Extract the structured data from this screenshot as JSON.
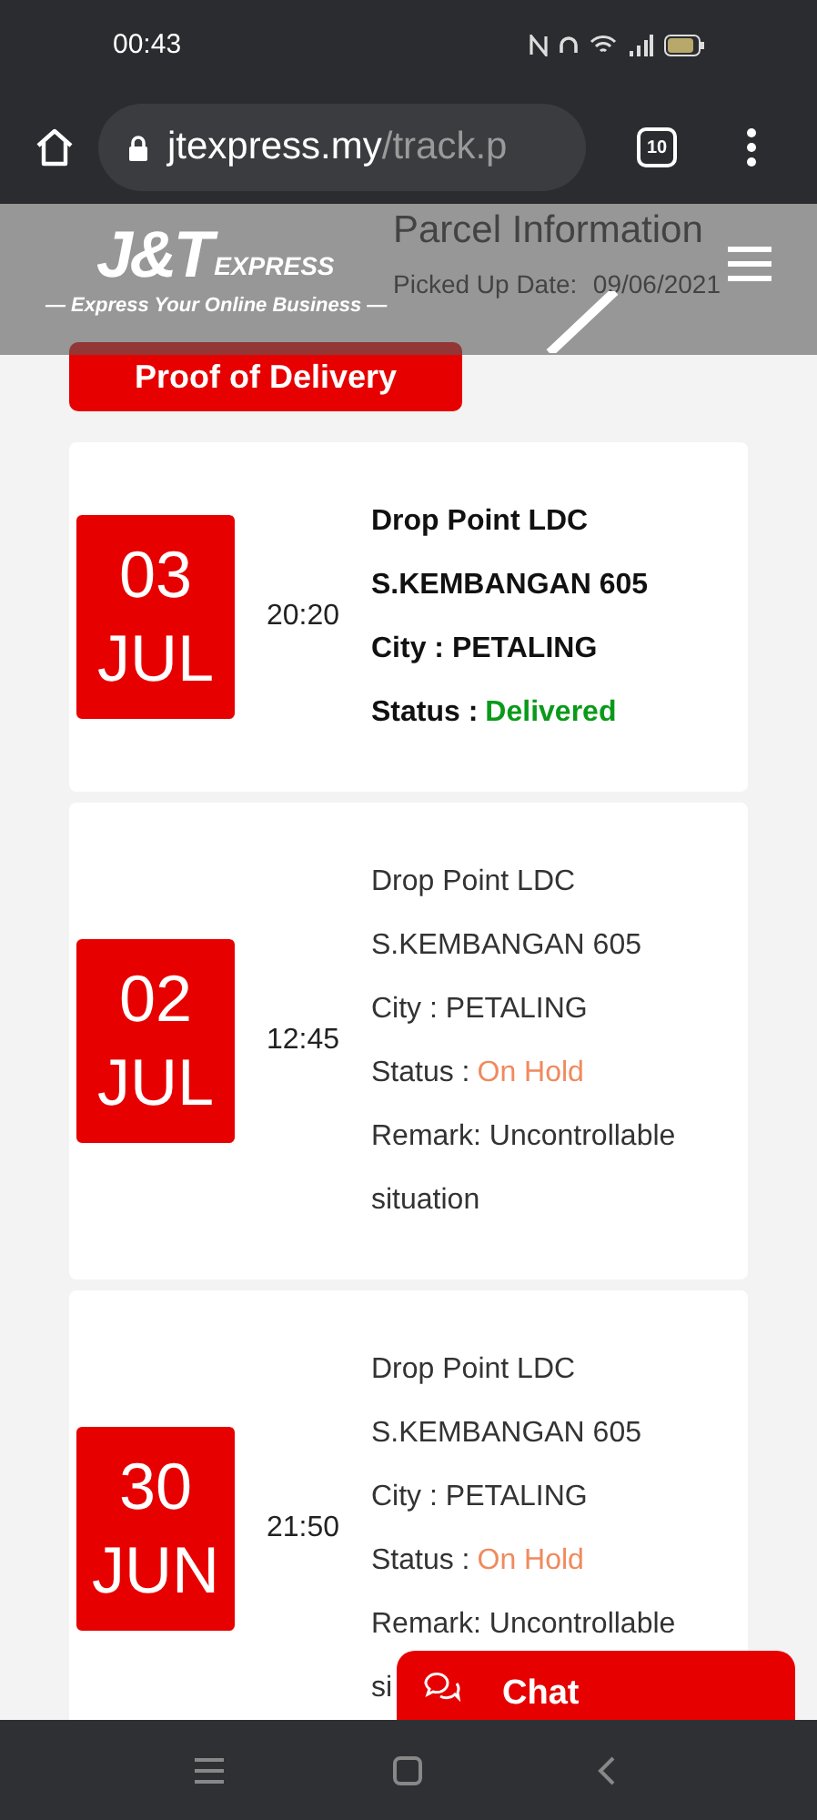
{
  "status_bar": {
    "time": "00:43"
  },
  "browser": {
    "url_host": "jtexpress.my",
    "url_path": "/track.p",
    "tab_count": "10"
  },
  "header": {
    "logo_mark": "J&T",
    "logo_word": "EXPRESS",
    "tagline": "— Express Your Online Business —"
  },
  "parcel_info": {
    "title": "Parcel Information",
    "picked_up_label": "Picked Up Date:",
    "picked_up_date": "09/06/2021"
  },
  "proof_button": "Proof of Delivery",
  "events": [
    {
      "day": "03",
      "month": "JUL",
      "time": "20:20",
      "highlighted": true,
      "location_lines": [
        "Drop Point LDC",
        "S.KEMBANGAN 605"
      ],
      "city": "City : PETALING",
      "status_label": "Status :",
      "status": "Delivered",
      "color": "#0a9a1a"
    },
    {
      "day": "02",
      "month": "JUL",
      "time": "12:45",
      "highlighted": false,
      "location_lines": [
        "Drop Point LDC",
        "S.KEMBANGAN 605"
      ],
      "city": "City : PETALING",
      "status_label": "Status :",
      "status": "On Hold",
      "color": "#f08a5d",
      "remark_lines": [
        "Remark: Uncontrollable",
        "situation"
      ]
    },
    {
      "day": "30",
      "month": "JUN",
      "time": "21:50",
      "highlighted": false,
      "location_lines": [
        "Drop Point LDC",
        "S.KEMBANGAN 605"
      ],
      "city": "City : PETALING",
      "status_label": "Status :",
      "status": "On Hold",
      "color": "#f08a5d",
      "remark_lines": [
        "Remark: Uncontrollable",
        "si"
      ]
    }
  ],
  "chat_button": "Chat"
}
